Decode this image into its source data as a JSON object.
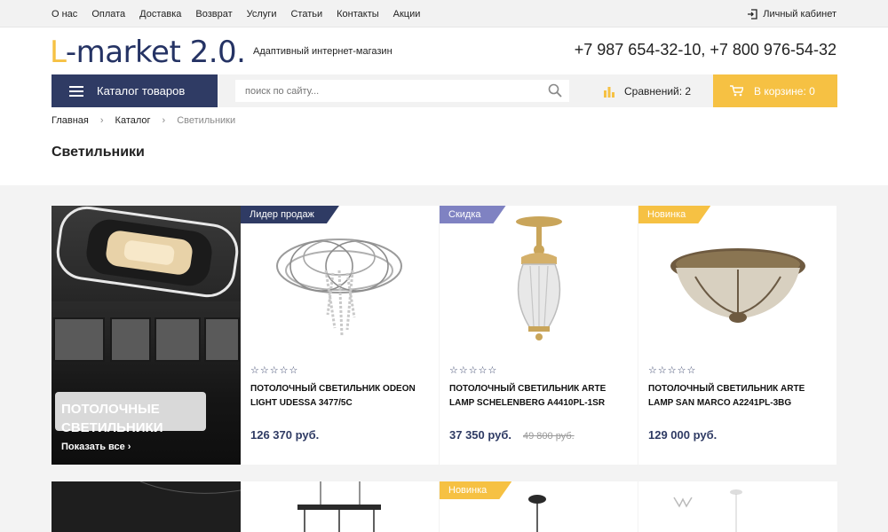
{
  "topnav": {
    "items": [
      "О нас",
      "Оплата",
      "Доставка",
      "Возврат",
      "Услуги",
      "Статьи",
      "Контакты",
      "Акции"
    ]
  },
  "account": {
    "label": "Личный кабинет"
  },
  "logo": {
    "first": "L",
    "rest": "-market 2.0."
  },
  "tagline": "Адаптивный интернет-магазин",
  "phones": "+7 987 654-32-10, +7 800 976-54-32",
  "catalog_button": "Каталог товаров",
  "search": {
    "placeholder": "поиск по сайту..."
  },
  "compare": {
    "label": "Сравнений: 2"
  },
  "cart": {
    "label": "В корзине: 0"
  },
  "breadcrumb": [
    "Главная",
    "Каталог",
    "Светильники"
  ],
  "page_title": "Светильники",
  "banner": {
    "title_line1": "ПОТОЛОЧНЫЕ",
    "title_line2": "СВЕТИЛЬНИКИ",
    "link": "Показать все ›"
  },
  "products": [
    {
      "badge": "Лидер продаж",
      "badge_color": "#2f3b64",
      "stars": "☆☆☆☆☆",
      "name": "ПОТОЛОЧНЫЙ СВЕТИЛЬНИК ODEON LIGHT UDESSA 3477/5C",
      "price": "126 370 руб.",
      "old_price": ""
    },
    {
      "badge": "Скидка",
      "badge_color": "#7f82c2",
      "stars": "☆☆☆☆☆",
      "name": "ПОТОЛОЧНЫЙ СВЕТИЛЬНИК ARTE LAMP SCHELENBERG A4410PL-1SR",
      "price": "37 350 руб.",
      "old_price": "49 800 руб."
    },
    {
      "badge": "Новинка",
      "badge_color": "#f6c143",
      "stars": "☆☆☆☆☆",
      "name": "ПОТОЛОЧНЫЙ СВЕТИЛЬНИК ARTE LAMP SAN MARCO A2241PL-3BG",
      "price": "129 000 руб.",
      "old_price": ""
    }
  ],
  "row2": {
    "badge": "Новинка"
  },
  "colors": {
    "brand_dark": "#2f3b64",
    "accent_yellow": "#f6c143",
    "discount_purple": "#7f82c2"
  }
}
